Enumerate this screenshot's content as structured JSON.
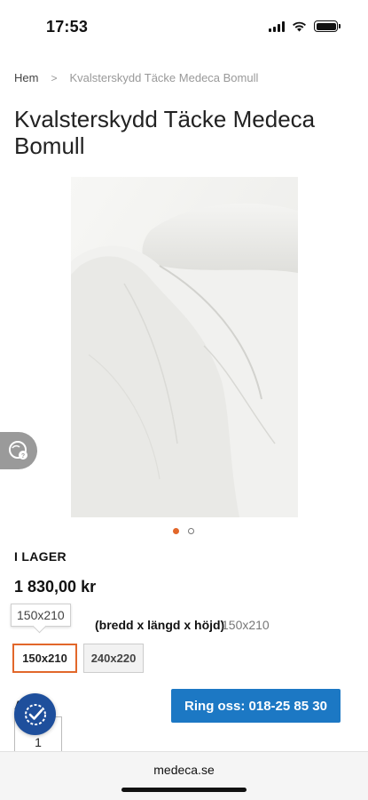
{
  "status_bar": {
    "time": "17:53"
  },
  "breadcrumb": {
    "home": "Hem",
    "separator": ">",
    "current": "Kvalsterskydd Täcke Medeca Bomull"
  },
  "product": {
    "title": "Kvalsterskydd Täcke Medeca Bomull",
    "stock_status": "I LAGER",
    "price": "1 830,00 kr",
    "image_icon": "duvet-product-photo",
    "carousel": {
      "total": 2,
      "active": 1
    }
  },
  "size": {
    "label": "(bredd x längd x höjd)",
    "selected_value": "150x210",
    "tooltip": "150x210",
    "options": [
      "150x210",
      "240x220"
    ]
  },
  "quantity": {
    "label": "A",
    "value": "1"
  },
  "actions": {
    "call_label": "Ring oss: 018-25 85 30"
  },
  "widgets": {
    "side_help_icon": "chat-help-icon",
    "badge_icon": "checkmark-badge-icon"
  },
  "browser": {
    "url": "medeca.se"
  },
  "colors": {
    "accent": "#e2672a",
    "call_button": "#1c78c4",
    "badge": "#1e4f9c"
  }
}
